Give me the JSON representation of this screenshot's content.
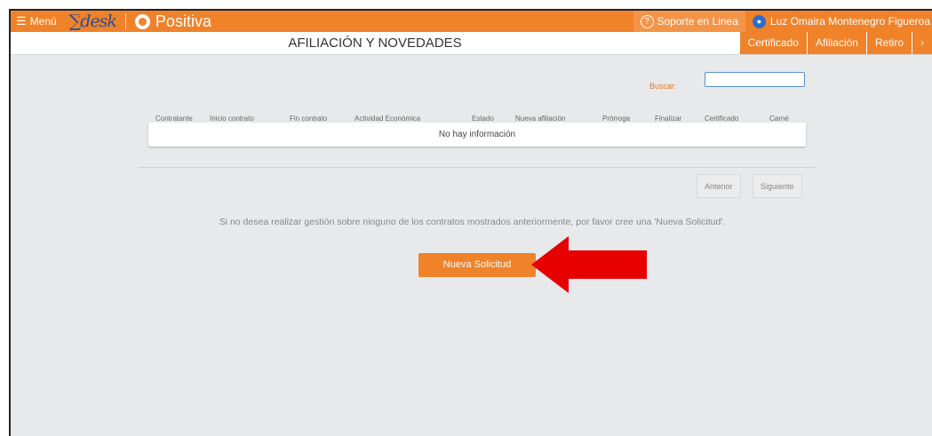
{
  "topbar": {
    "menu_label": "Menú",
    "desk_logo": "∑desk",
    "brand": "Positiva",
    "support_label": "Soporte en Linea",
    "user_name": "Luz Omaira Montenegro Figueroa"
  },
  "header": {
    "title": "AFILIACIÓN Y NOVEDADES",
    "tabs": [
      {
        "label": "Certificado"
      },
      {
        "label": "Afiliación"
      },
      {
        "label": "Retiro"
      },
      {
        "label": "›"
      }
    ]
  },
  "search": {
    "label": "Buscar:",
    "value": ""
  },
  "table": {
    "columns": [
      "Contratante",
      "Inicio contrato",
      "Fin contrato",
      "Actividad Económica",
      "Estado",
      "Nueva afiliación",
      "Prórroga",
      "Finalizar",
      "Certificado",
      "Carné"
    ],
    "empty_message": "No hay información"
  },
  "pager": {
    "previous": "Anterior",
    "next": "Siguiente"
  },
  "info_text": "Si no desea realizar gestión sobre ninguno de los contratos mostrados anteriormente, por favor cree una 'Nueva Solicitud'.",
  "new_request_button": "Nueva Solicitud",
  "colors": {
    "accent": "#f0822a",
    "annotation_arrow": "#e60000",
    "background": "#e8e9ea"
  }
}
